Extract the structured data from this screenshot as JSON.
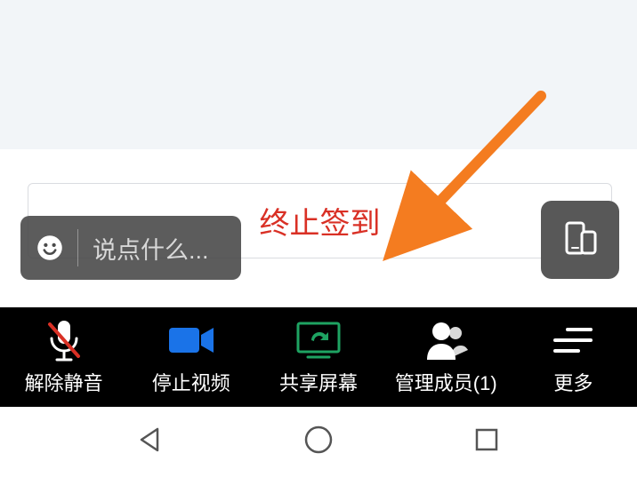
{
  "stop_signin_label": "终止签到",
  "chat_placeholder": "说点什么...",
  "toolbar": {
    "unmute": "解除静音",
    "stop_video": "停止视频",
    "share_screen": "共享屏幕",
    "manage_members": "管理成员(1)",
    "more": "更多"
  }
}
